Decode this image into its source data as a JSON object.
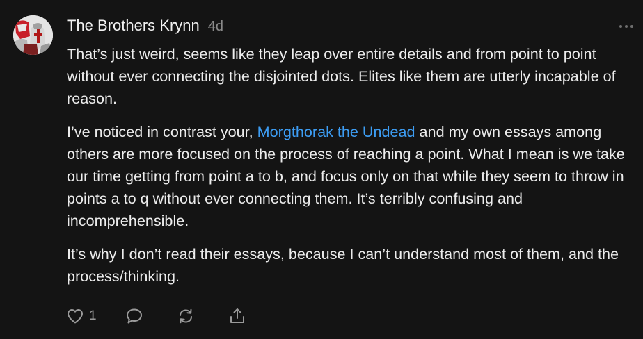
{
  "comment": {
    "author": "The Brothers Krynn",
    "time": "4d",
    "avatar_icon": "templar-knight-avatar",
    "more_icon": "more-dots-icon",
    "paragraphs": [
      {
        "text": "That’s just weird, seems like they leap over entire details and from point to point without ever connecting the disjointed dots. Elites like them are utterly incapable of reason."
      },
      {
        "before": "I’ve noticed in contrast your, ",
        "mention": "Morgthorak the Undead",
        "after": " and my own essays among others are more focused on the process of reaching a point. What I mean is we take our time getting from point a to b, and focus only on that while they seem to throw in points a to q without ever connecting them. It’s terribly confusing and incomprehensible."
      },
      {
        "text": "It’s why I don’t read their essays, because I can’t understand most of them, and the process/thinking."
      }
    ],
    "actions": {
      "like_count": "1",
      "like_icon": "heart-icon",
      "reply_icon": "comment-bubble-icon",
      "restack_icon": "restack-icon",
      "share_icon": "share-icon"
    },
    "colors": {
      "background": "#141414",
      "text": "#ececec",
      "muted": "#8a8a8a",
      "mention": "#3d9df3"
    }
  }
}
